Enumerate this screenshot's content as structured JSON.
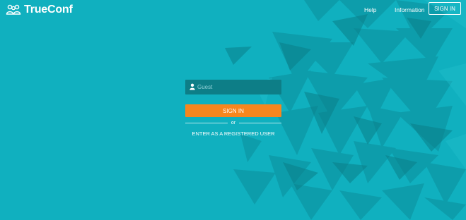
{
  "brand": {
    "name": "TrueConf",
    "logo_icon": "trueconf-people-logo"
  },
  "nav": {
    "help": "Help",
    "information": "Information",
    "sign_in": "SIGN IN"
  },
  "login_form": {
    "username_placeholder": "Guest",
    "username_value": "",
    "user_icon": "user-icon",
    "sign_in_button": "SIGN IN",
    "or_text": "or",
    "registered_link": "ENTER AS A REGISTERED USER"
  },
  "colors": {
    "background": "#10b0bf",
    "field": "#0d7e87",
    "primary_button": "#f7861e",
    "text": "#ffffff"
  }
}
